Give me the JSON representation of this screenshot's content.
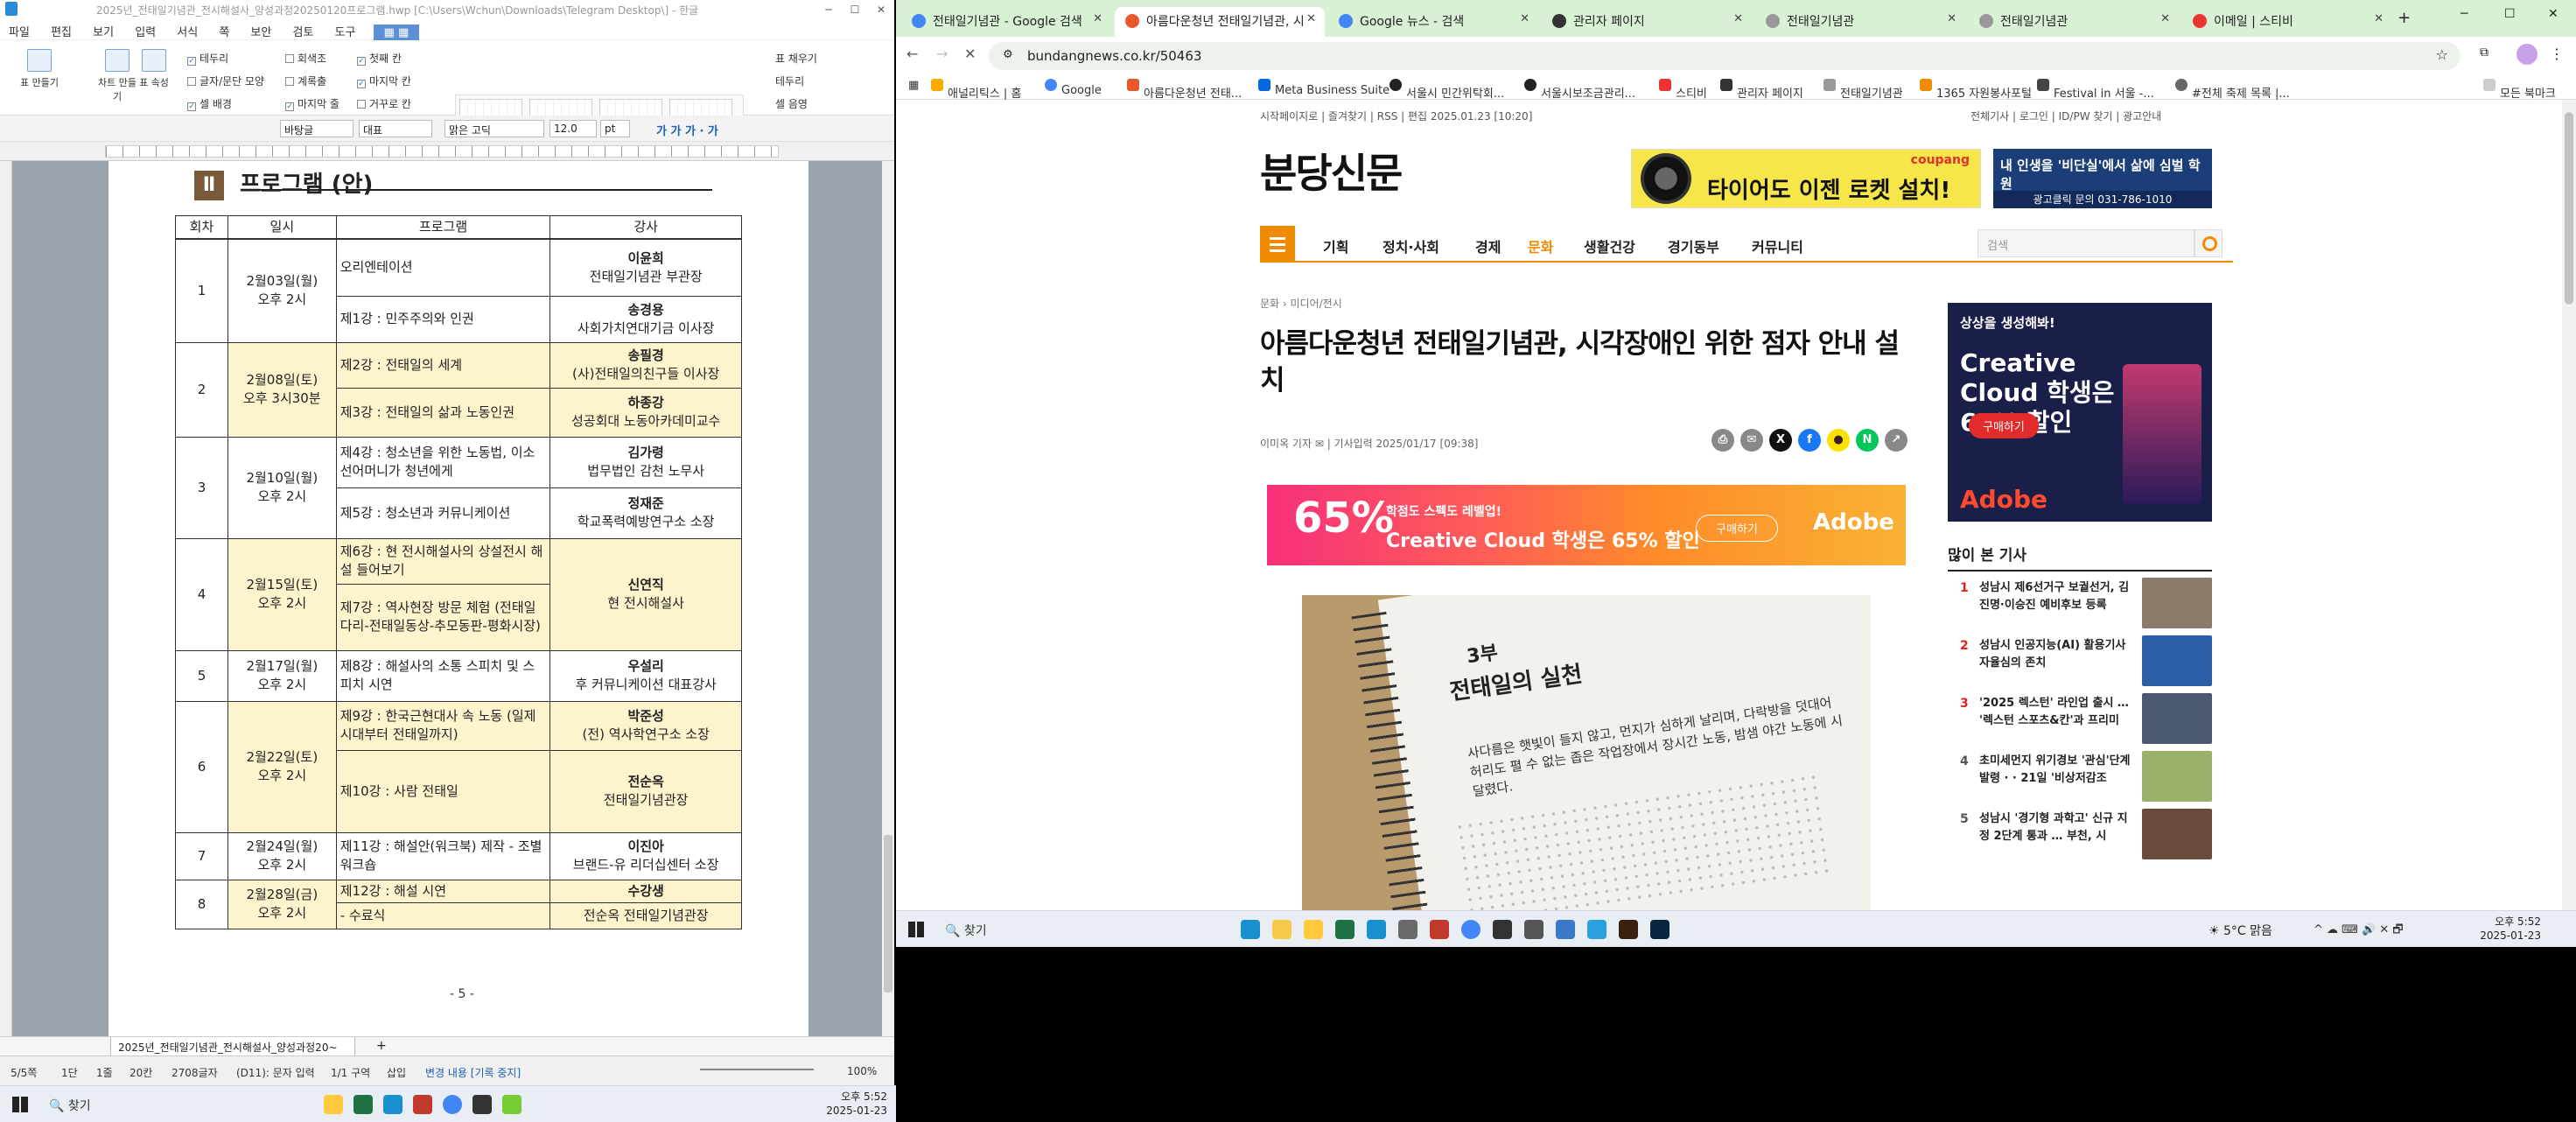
{
  "hwp": {
    "title": "2025년_전태일기념관_전시해설사_양성과정20250120프로그램.hwp [C:\\Users\\Wchun\\Downloads\\Telegram Desktop\\] - 한글",
    "menu": [
      "파일",
      "편집",
      "보기",
      "입력",
      "서식",
      "쪽",
      "보안",
      "검토",
      "도구"
    ],
    "ribbon": {
      "frame_label": "표 만들기",
      "chart_label": "차트 만들기",
      "props_label": "표 속성",
      "checks": [
        "테두리",
        "글자/문단 모양",
        "셀 배경",
        "회색조",
        "계록출",
        "마지막 줄",
        "첫째 칸",
        "마지막 칸",
        "거꾸로 칸"
      ],
      "right": [
        "표 채우기",
        "테두리",
        "셀 음영"
      ]
    },
    "fmt": {
      "style": "바탕글",
      "lang": "대표",
      "font": "맑은 고딕",
      "size": "12.0",
      "unit": "pt"
    },
    "doc": {
      "section_num": "Ⅱ",
      "section_title": "프로그램 (안)",
      "headers": [
        "회차",
        "일시",
        "프로그램",
        "강사"
      ],
      "rows": [
        {
          "n": "1",
          "date": "2월03일(월)",
          "time": "오후 2시",
          "p1": "오리엔테이션",
          "i1n": "이윤희",
          "i1r": "전태일기념관 부관장",
          "p2": "제1강 : 민주주의와 인권",
          "i2n": "송경용",
          "i2r": "사회가치연대기금 이사장"
        },
        {
          "n": "2",
          "date": "2월08일(토)",
          "time": "오후 3시30분",
          "p1": "제2강 : 전태일의 세계",
          "i1n": "송필경",
          "i1r": "(사)전태일의친구들 이사장",
          "p2": "제3강 : 전태일의 삶과 노동인권",
          "i2n": "하종강",
          "i2r": "성공회대 노동아카데미교수"
        },
        {
          "n": "3",
          "date": "2월10일(월)",
          "time": "오후 2시",
          "p1": "제4강 : 청소년을 위한 노동법, 이소선어머니가 청년에게",
          "i1n": "김가령",
          "i1r": "법무법인 감천 노무사",
          "p2": "제5강 : 청소년과 커뮤니케이션",
          "i2n": "정재준",
          "i2r": "학교폭력예방연구소 소장"
        },
        {
          "n": "4",
          "date": "2월15일(토)",
          "time": "오후 2시",
          "p1": "제6강 : 현 전시해설사의 상설전시 해설 들어보기",
          "p2": "제7강 : 역사현장 방문 체험 (전태일다리-전태일동상-추모동판-평화시장)",
          "i1n": "신연직",
          "i1r": "현 전시해설사"
        },
        {
          "n": "5",
          "date": "2월17일(월)",
          "time": "오후 2시",
          "p1": "제8강 : 해설사의 소통 스피치 및 스피치 시연",
          "i1n": "우설리",
          "i1r": "후 커뮤니케이션 대표강사"
        },
        {
          "n": "6",
          "date": "2월22일(토)",
          "time": "오후 2시",
          "p1": "제9강 : 한국근현대사 속 노동 (일제시대부터 전태일까지)",
          "i1n": "박준성",
          "i1r": "(전) 역사학연구소 소장",
          "p2": "제10강 : 사람 전태일",
          "i2n": "전순옥",
          "i2r": "전태일기념관장"
        },
        {
          "n": "7",
          "date": "2월24일(월)",
          "time": "오후 2시",
          "p1": "제11강 : 해설안(워크북) 제작 - 조별 워크숍",
          "i1n": "이진아",
          "i1r": "브랜드-유 리더십센터 소장"
        },
        {
          "n": "8",
          "date": "2월28일(금)",
          "time": "오후 2시",
          "p1": "제12강 : 해설 시연",
          "i1n": "수강생",
          "p2": "- 수료식",
          "i2r": "전순옥 전태일기념관장"
        }
      ],
      "page_num": "- 5 -"
    },
    "tab_label": "2025년_전태일기념관_전시해설사_양성과정20~",
    "status": [
      "5/5쪽",
      "1단",
      "1줄",
      "20칸",
      "2708글자",
      "(D11): 문자 입력",
      "1/1 구역",
      "삽입",
      "변경 내용 [기록 중지]",
      "100%"
    ]
  },
  "taskbar_left": {
    "search": "찾기",
    "time": "오후 5:52",
    "date": "2025-01-23"
  },
  "chrome": {
    "tabs": [
      {
        "label": "전태일기념관 - Google 검색",
        "color": "#4285f4"
      },
      {
        "label": "아름다운청년 전태일기념관, 시",
        "color": "#e8582b",
        "active": true
      },
      {
        "label": "Google 뉴스 - 검색",
        "color": "#4285f4"
      },
      {
        "label": "관리자 페이지",
        "color": "#333"
      },
      {
        "label": "전태일기념관",
        "color": "#888"
      },
      {
        "label": "전태일기념관",
        "color": "#888"
      },
      {
        "label": "이메일 | 스티비",
        "color": "#e33"
      }
    ],
    "url": "bundangnews.co.kr/50463",
    "bookmarks": [
      "애널리틱스 | 홈",
      "Google",
      "아름다운청년 전태...",
      "Meta Business Suite",
      "서울시 민간위탁회...",
      "서울시보조금관리...",
      "스티비",
      "관리자 페이지",
      "전태일기념관",
      "1365 자원봉사포털",
      "Festival in 서울 -...",
      "#전체 축제 목록 |...",
      "모든 북마크"
    ],
    "site": {
      "topleft": [
        "시작페이지로",
        "즐겨찾기",
        "RSS",
        "편집 2025.01.23 [10:20]"
      ],
      "topright": [
        "전체기사",
        "로그인",
        "ID/PW 찾기",
        "광고안내"
      ],
      "logo": "분당신문",
      "ad1_brand": "coupang",
      "ad1_text": "타이어도 이젠 로켓 설치!",
      "ad2_text": "내 인생을 '비단실'에서 삶에 심벌 학원",
      "ad2_phone": "광고클릭 문의 031-786-1010",
      "nav": [
        "기획",
        "정치·사회",
        "경제",
        "문화",
        "생활건강",
        "경기동부",
        "커뮤니티"
      ],
      "nav_active": 3,
      "search_placeholder": "검색",
      "crumb": "문화 › 미디어/전시",
      "headline": "아름다운청년 전태일기념관, 시각장애인 위한 점자 안내 설치",
      "byline": "이미옥 기자 ✉ | 기사입력 2025/01/17 [09:38]",
      "banner": {
        "pct": "65%",
        "t1": "학점도 스펙도 레벨업!",
        "t2": "Creative Cloud 학생은 65% 할인",
        "btn": "구매하기",
        "brand": "Adobe"
      },
      "photo": {
        "h1": "3부",
        "h2": "전태일의 실천",
        "p": "사다름은 햇빛이 들지 않고, 먼지가 심하게 날리며, 다락방을 덧대어 허리도 펼 수 없는 좁은 작업장에서 장시간 노동, 밤샘 야간 노동에 시달렸다."
      },
      "side_ad": {
        "a": "상상을 생성해봐!",
        "b": "Creative Cloud 학생은 65% 할인",
        "btn": "구매하기",
        "brand": "Adobe"
      },
      "most_read_title": "많이 본 기사",
      "most_read": [
        {
          "n": "1",
          "t": "성남시 제6선거구 보궐선거, 김진명·이승진 예비후보 등록"
        },
        {
          "n": "2",
          "t": "성남시 인공지능(AI) 활용기사 자율심의 존치"
        },
        {
          "n": "3",
          "t": "'2025 렉스턴' 라인업 출시 … '렉스턴 스포츠&칸'과 프리미"
        },
        {
          "n": "4",
          "t": "초미세먼지 위기경보 '관심'단계 발령 · · 21일 '비상저감조"
        },
        {
          "n": "5",
          "t": "성남시 '경기형 과학고' 신규 지정 2단계 통과 … 부천, 시"
        }
      ]
    }
  },
  "taskbar_right": {
    "search": "찾기",
    "weather": "5°C 맑음",
    "time": "오후 5:52",
    "date": "2025-01-23"
  }
}
